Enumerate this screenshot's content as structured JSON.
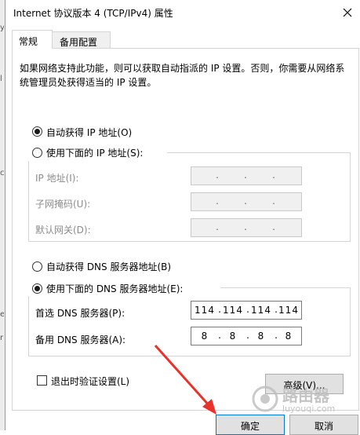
{
  "window": {
    "title": "Internet 协议版本 4 (TCP/IPv4) 属性",
    "close_icon": "close-icon"
  },
  "tabs": [
    {
      "label": "常规",
      "active": true
    },
    {
      "label": "备用配置",
      "active": false
    }
  ],
  "description": "如果网络支持此功能，则可以获取自动指派的 IP 设置。否则，你需要从网络系统管理员处获得适当的 IP 设置。",
  "ip_section": {
    "auto_label": "自动获得 IP 地址(O)",
    "auto_selected": true,
    "manual_label": "使用下面的 IP 地址(S):",
    "manual_selected": false,
    "fields": [
      {
        "label": "IP 地址(I):",
        "value": [
          "",
          "",
          "",
          ""
        ]
      },
      {
        "label": "子网掩码(U):",
        "value": [
          "",
          "",
          "",
          ""
        ]
      },
      {
        "label": "默认网关(D):",
        "value": [
          "",
          "",
          "",
          ""
        ]
      }
    ]
  },
  "dns_section": {
    "auto_label": "自动获得 DNS 服务器地址(B)",
    "auto_selected": false,
    "manual_label": "使用下面的 DNS 服务器地址(E):",
    "manual_selected": true,
    "preferred": {
      "label": "首选 DNS 服务器(P):",
      "value": [
        "114",
        "114",
        "114",
        "114"
      ]
    },
    "alternate": {
      "label": "备用 DNS 服务器(A):",
      "value": [
        "8",
        "8",
        "8",
        "8"
      ]
    }
  },
  "validate_on_exit": {
    "label": "退出时验证设置(L)",
    "checked": false
  },
  "buttons": {
    "advanced": "高级(V)...",
    "ok": "确定",
    "cancel": "取消"
  },
  "watermark": {
    "text": "路由器",
    "subtext": "luyouqi.com"
  },
  "colors": {
    "arrow": "#e8322b",
    "accent": "#0078d7",
    "disabled_text": "#8c8c8c"
  }
}
